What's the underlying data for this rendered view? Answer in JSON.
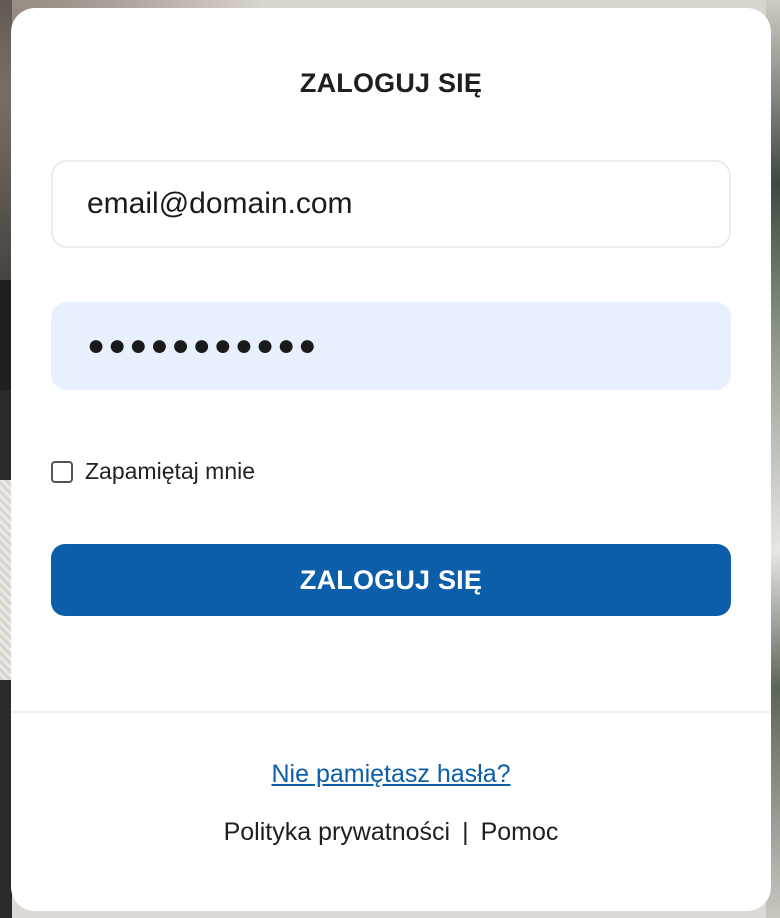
{
  "login": {
    "title": "ZALOGUJ SIĘ",
    "email_value": "email@domain.com",
    "password_masked": "●●●●●●●●●●●",
    "remember_label": "Zapamiętaj mnie",
    "remember_checked": false,
    "submit_label": "ZALOGUJ SIĘ"
  },
  "footer": {
    "forgot_link": "Nie pamiętasz hasła?",
    "privacy_link": "Polityka prywatności",
    "separator": "|",
    "help_link": "Pomoc"
  },
  "colors": {
    "accent": "#0d5ea8",
    "password_bg": "#e8f0fd"
  }
}
